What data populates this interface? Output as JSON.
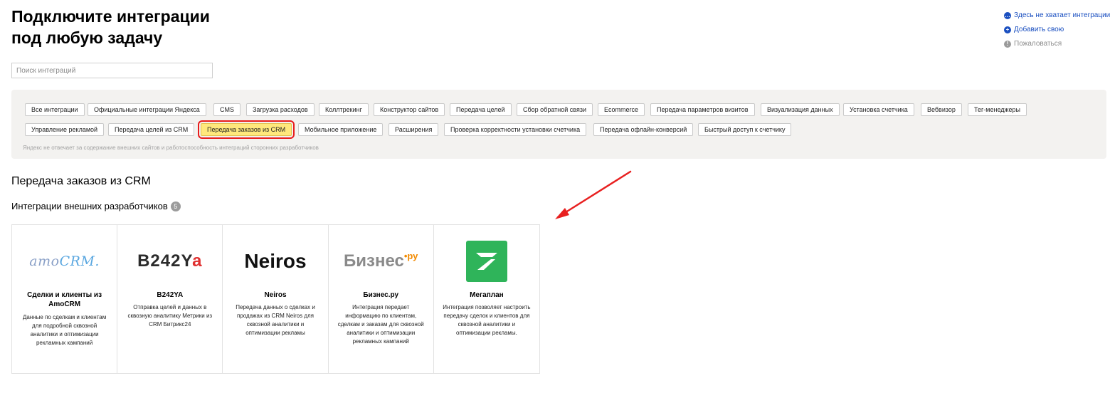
{
  "header": {
    "title_line1": "Подключите интеграции",
    "title_line2": "под любую задачу"
  },
  "side_links": [
    {
      "label": "Здесь не хватает интеграции",
      "icon": "chat-icon"
    },
    {
      "label": "Добавить свою",
      "icon": "plus-icon"
    },
    {
      "label": "Пожаловаться",
      "icon": "warning-icon"
    }
  ],
  "search": {
    "placeholder": "Поиск интеграций"
  },
  "filters": {
    "row1": [
      "Все интеграции",
      "Официальные интеграции Яндекса",
      "CMS",
      "Загрузка расходов",
      "Коллтрекинг",
      "Конструктор сайтов",
      "Передача целей",
      "Сбор обратной связи",
      "Ecommerce",
      "Передача параметров визитов",
      "Визуализация данных",
      "Установка счетчика",
      "Вебвизор",
      "Тег-менеджеры"
    ],
    "row2": [
      "Управление рекламой",
      "Передача целей из CRM",
      "Передача заказов из CRM",
      "Мобильное приложение",
      "Расширения",
      "Проверка корректности установки счетчика",
      "Передача офлайн-конверсий",
      "Быстрый доступ к счетчику"
    ],
    "active": "Передача заказов из CRM",
    "disclaimer": "Яндекс не отвечает за содержание внешних сайтов и работоспособность интеграций сторонних разработчиков"
  },
  "section": {
    "title": "Передача заказов из CRM",
    "subtitle": "Интеграции внешних разработчиков",
    "count": "5"
  },
  "cards": [
    {
      "logo_main": "amo",
      "logo_accent": "CRM.",
      "name": "Сделки и клиенты из AmoCRM",
      "desc": "Данные по сделкам и клиентам для подробной сквозной аналитики и оптимизации рекламных кампаний"
    },
    {
      "logo_main": "B242Y",
      "logo_accent": "a",
      "name": "B242YA",
      "desc": "Отправка целей и данных в сквозную аналитику Метрики из CRM Битрикс24"
    },
    {
      "logo_main": "Neiros",
      "name": "Neiros",
      "desc": "Передача данных о сделках и продажах из CRM Neiros для сквозной аналитики и оптимизации рекламы"
    },
    {
      "logo_main": "Бизнес",
      "logo_accent": "•ру",
      "name": "Бизнес.ру",
      "desc": "Интеграция передает информацию по клиентам, сделкам и заказам для сквозной аналитики и оптимизации рекламных кампаний"
    },
    {
      "logo_icon": "megaplan-logo-icon",
      "name": "Мегаплан",
      "desc": "Интеграция позволяет настроить передачу сделок и клиентов для сквозной аналитики и оптимизации рекламы."
    }
  ],
  "colors": {
    "accent_link": "#1a4fc0",
    "active_chip": "#ffe87c",
    "highlight_border": "#e81c1c",
    "megaplan_green": "#2fb45a"
  }
}
